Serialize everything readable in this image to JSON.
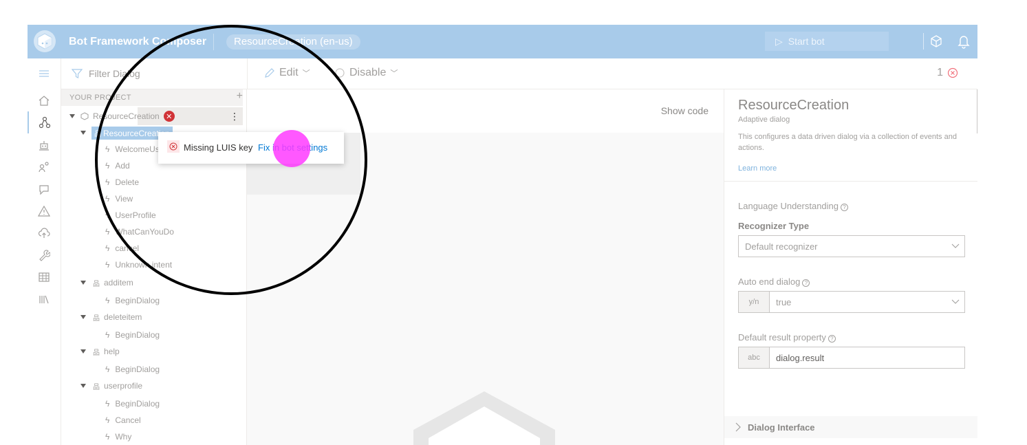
{
  "header": {
    "app_title": "Bot Framework Composer",
    "project_pill": "ResourceCreation (en-us)",
    "start_bot": "Start bot",
    "brand_color": "#a8cbea"
  },
  "rail": {
    "items": [
      "hamburger-icon",
      "home-icon",
      "design-icon",
      "bot-responses-icon",
      "knowledge-icon",
      "qna-icon",
      "diagnostics-icon",
      "publish-icon",
      "settings-icon",
      "table-icon",
      "library-icon"
    ]
  },
  "filter": {
    "placeholder": "Filter Dialog"
  },
  "toolbar": {
    "edit": "Edit",
    "disable": "Disable",
    "error_count": "1"
  },
  "tree": {
    "header": "YOUR PROJECT",
    "root": "ResourceCreation",
    "dialog_selected": "ResourceCreation",
    "triggers_main": [
      "WelcomeUser",
      "Add",
      "Delete",
      "View",
      "UserProfile",
      "WhatCanYouDo",
      "cancel",
      "Unknown intent"
    ],
    "groups": [
      {
        "name": "additem",
        "triggers": [
          "BeginDialog"
        ]
      },
      {
        "name": "deleteitem",
        "triggers": [
          "BeginDialog"
        ]
      },
      {
        "name": "help",
        "triggers": [
          "BeginDialog"
        ]
      },
      {
        "name": "userprofile",
        "triggers": [
          "BeginDialog",
          "Cancel",
          "Why"
        ]
      }
    ]
  },
  "canvas": {
    "show_code": "Show code"
  },
  "tooltip": {
    "message": "Missing LUIS key",
    "link": "Fix in bot settings"
  },
  "props": {
    "title": "ResourceCreation",
    "subtitle": "Adaptive dialog",
    "description": "This configures a data driven dialog via a collection of events and actions.",
    "learn_more": "Learn more",
    "lu_label": "Language Understanding",
    "recognizer_label": "Recognizer Type",
    "recognizer_value": "Default recognizer",
    "auto_end_label": "Auto end dialog",
    "auto_end_prefix": "y/n",
    "auto_end_value": "true",
    "result_label": "Default result property",
    "result_prefix": "abc",
    "result_value": "dialog.result",
    "interface_label": "Dialog Interface"
  }
}
